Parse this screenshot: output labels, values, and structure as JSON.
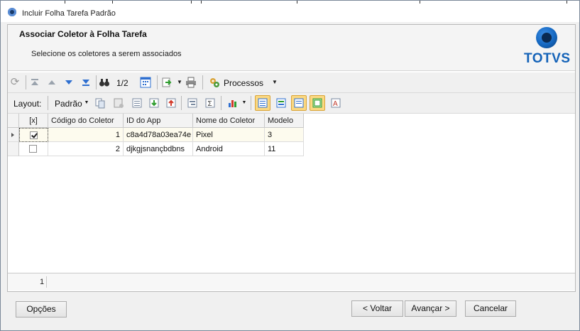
{
  "window": {
    "title": "Incluir Folha Tarefa Padrão"
  },
  "header": {
    "title": "Associar Coletor à Folha Tarefa",
    "subtitle": "Selecione os coletores a serem associados",
    "logo_text": "TOTVS"
  },
  "toolbar1": {
    "page_indicator": "1/2",
    "processes_label": "Processos",
    "icons": [
      "refresh-icon",
      "first-record-icon",
      "previous-record-icon",
      "next-record-icon",
      "last-record-icon",
      "search-binoculars-icon",
      "grid-calendar-icon",
      "export-icon",
      "print-icon",
      "processes-gear-icon"
    ]
  },
  "toolbar2": {
    "layout_label": "Layout:",
    "layout_value": "Padrão"
  },
  "grid": {
    "columns": [
      "[x]",
      "Código do Coletor",
      "ID do App",
      "Nome do Coletor",
      "Modelo"
    ],
    "rows": [
      {
        "checked": true,
        "codigo": "1",
        "id_app": "c8a4d78a03ea74e",
        "nome": "Pixel",
        "modelo": "3"
      },
      {
        "checked": false,
        "codigo": "2",
        "id_app": "djkgjsnançbdbns",
        "nome": "Android",
        "modelo": "11"
      }
    ],
    "record_count": "1"
  },
  "buttons": {
    "options": "Opções",
    "back": "< Voltar",
    "next": "Avançar >",
    "cancel": "Cancelar"
  },
  "colors": {
    "accent": "#1563b8",
    "highlight": "#fbd881",
    "selected_row": "#fdfbee"
  }
}
